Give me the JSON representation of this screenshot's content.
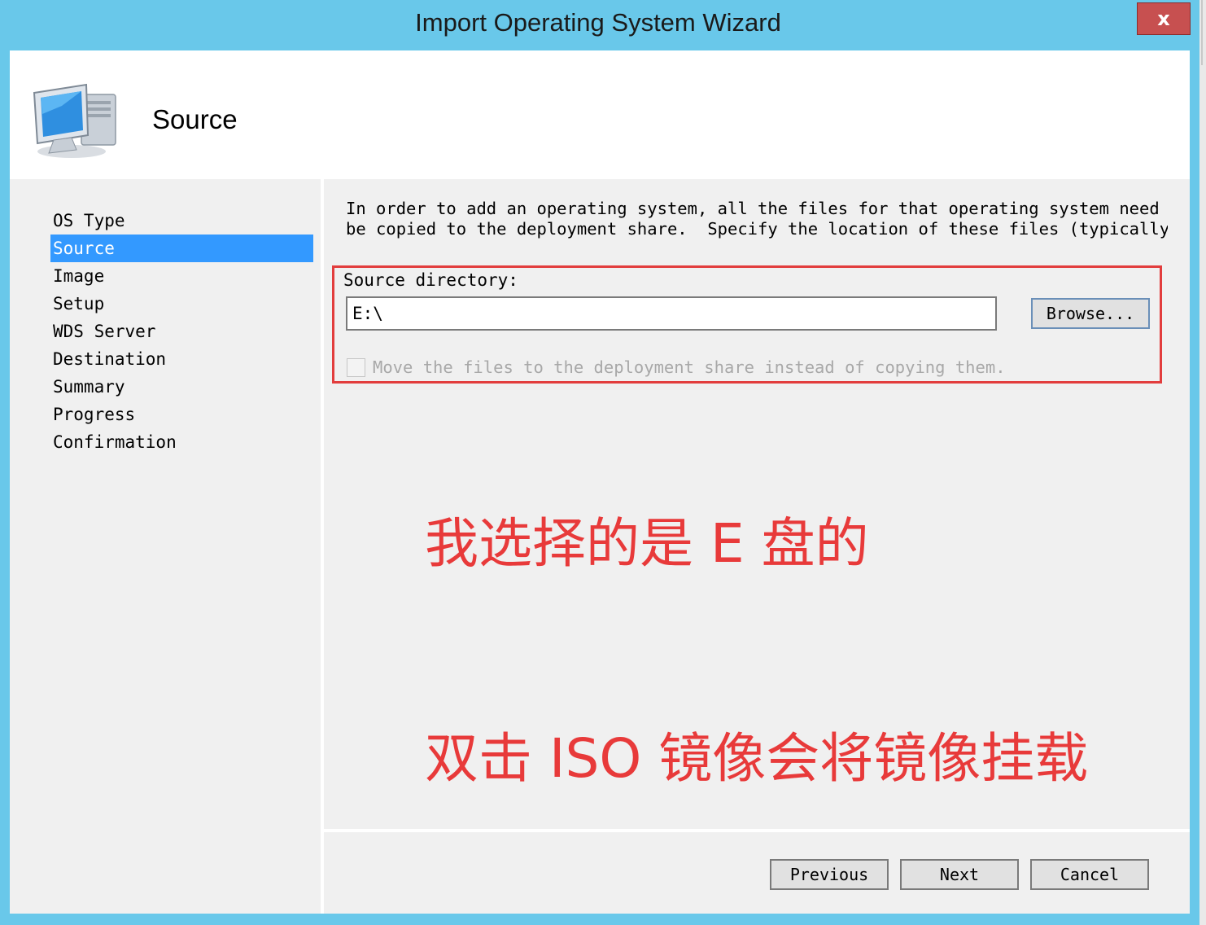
{
  "window": {
    "title": "Import Operating System Wizard",
    "close_glyph": "x"
  },
  "header": {
    "title": "Source",
    "icon": "computer-icon"
  },
  "nav": {
    "items": [
      {
        "label": "OS Type",
        "active": false
      },
      {
        "label": "Source",
        "active": true
      },
      {
        "label": "Image",
        "active": false
      },
      {
        "label": "Setup",
        "active": false
      },
      {
        "label": "WDS Server",
        "active": false
      },
      {
        "label": "Destination",
        "active": false
      },
      {
        "label": "Summary",
        "active": false
      },
      {
        "label": "Progress",
        "active": false
      },
      {
        "label": "Confirmation",
        "active": false
      }
    ]
  },
  "content": {
    "intro_line1": "In order to add an operating system, all the files for that operating system need to",
    "intro_line2": "be copied to the deployment share.  Specify the location of these files (typically a",
    "source_label": "Source directory:",
    "source_value": "E:\\",
    "browse_label": "Browse...",
    "move_checkbox_label": "Move the files to the deployment share instead of copying them.",
    "move_checked": false
  },
  "annotations": {
    "line1": "我选择的是 E 盘的",
    "line2": "双击 ISO 镜像会将镜像挂载",
    "color": "#e83a3a"
  },
  "footer": {
    "previous_label": "Previous",
    "next_label": "Next",
    "cancel_label": "Cancel"
  },
  "colors": {
    "titlebar": "#69c8ea",
    "selection": "#3399ff",
    "close": "#c75050",
    "highlight_box": "#e23d3d"
  }
}
